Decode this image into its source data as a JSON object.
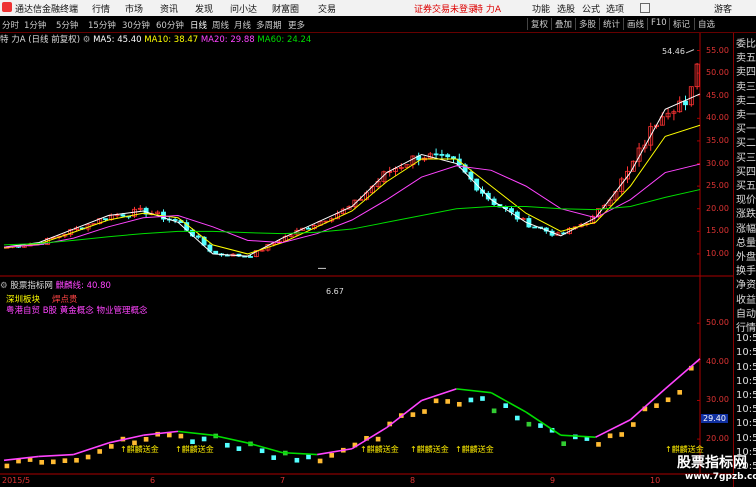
{
  "topbar": {
    "app_title": "通达信金融终端",
    "menu": [
      "行情",
      "市场",
      "资讯",
      "发现",
      "问小达",
      "财富圈",
      "交易"
    ],
    "login_status": "证券交易未登录",
    "stock_name_top": "特 力A",
    "right_menu": [
      "功能",
      "选股",
      "公式",
      "选项"
    ],
    "guest": "游客"
  },
  "toolbar": {
    "periods": [
      "分时",
      "1分钟",
      "5分钟",
      "15分钟",
      "30分钟",
      "60分钟",
      "日线",
      "周线",
      "月线",
      "多周期",
      "更多"
    ],
    "active_period": "日线",
    "buttons": [
      "复权",
      "叠加",
      "多股",
      "统计",
      "画线",
      "F10",
      "标记",
      "自选"
    ]
  },
  "main_chart": {
    "stock_title": "特 力A (日线 前复权)",
    "ma": [
      {
        "label": "MA5: 45.40",
        "color": "#ffffff"
      },
      {
        "label": "MA10: 38.47",
        "color": "#ffff00"
      },
      {
        "label": "MA20: 29.88",
        "color": "#ff44ff"
      },
      {
        "label": "MA60: 24.24",
        "color": "#00dd00"
      }
    ],
    "high_label": "54.46",
    "low_label": "6.67",
    "y_ticks": [
      "55.00",
      "50.00",
      "45.00",
      "40.00",
      "35.00",
      "30.00",
      "25.00",
      "20.00",
      "15.00",
      "10.00"
    ],
    "y_range": [
      6,
      56
    ]
  },
  "indicator": {
    "title": "股票指标网",
    "series_label": "麒麟线: 40.80",
    "sector_label": "深圳板块",
    "sector_value": "焊点贵",
    "concepts": "粤港自贸 B股 黄金概念 物业管理概念",
    "current_value": "29.40",
    "y_ticks": [
      "50.00",
      "40.00",
      "30.00",
      "20.00"
    ],
    "y_range": [
      12,
      56
    ],
    "signal_text": "麒麟送金"
  },
  "x_dates": [
    "2015/5",
    "6",
    "7",
    "8",
    "9",
    "10"
  ],
  "side_panel": {
    "items": [
      "委比",
      "卖五",
      "卖四",
      "卖三",
      "卖二",
      "卖一",
      "买一",
      "买二",
      "买三",
      "买四",
      "买五",
      "现价",
      "涨跌",
      "涨幅",
      "总量",
      "外盘",
      "换手",
      "净资",
      "收益",
      "自动",
      "行情",
      "10:5",
      "10:5",
      "10:5",
      "10:5",
      "10:5",
      "10:5",
      "10:5",
      "10:5",
      "10:5",
      "10:5"
    ]
  },
  "watermark": {
    "line1": "股票指标网",
    "line2": "www.7gpzb.com"
  },
  "colors": {
    "up": "#ff3333",
    "down": "#54ffff",
    "ma5": "#ffffff",
    "ma10": "#ffff00",
    "ma20": "#ff44ff",
    "ma60": "#00dd00",
    "axis": "#aa0000"
  },
  "chart_data": {
    "type": "candlestick",
    "categories": [
      "2015/5",
      "6",
      "7",
      "8",
      "9",
      "10"
    ],
    "series": [
      {
        "name": "MA5",
        "values": [
          11.5,
          12.5,
          15.5,
          18.5,
          19.5,
          17,
          10,
          9.5,
          13.5,
          17,
          20.5,
          28,
          32,
          30,
          22,
          17,
          14,
          18,
          28,
          42,
          45.4
        ]
      },
      {
        "name": "MA10",
        "values": [
          11.3,
          12.2,
          14.8,
          17.5,
          19,
          18,
          12,
          10,
          12.5,
          16,
          19.5,
          26,
          31,
          31,
          25,
          19,
          15,
          17,
          25,
          36,
          38.47
        ]
      },
      {
        "name": "MA20",
        "values": [
          11.5,
          12,
          13.5,
          16,
          18,
          18.5,
          16,
          13,
          12.5,
          14.5,
          17.5,
          22,
          27,
          29.5,
          28.5,
          25,
          20,
          18,
          22,
          28,
          29.88
        ]
      },
      {
        "name": "MA60",
        "values": [
          12,
          12.3,
          13,
          13.8,
          14.5,
          15,
          15,
          14.7,
          14.5,
          14.8,
          15.5,
          17,
          18.5,
          20,
          20.5,
          20.5,
          20,
          19.8,
          20.5,
          22.5,
          24.24
        ]
      },
      {
        "name": "麒麟线",
        "values": [
          14.5,
          15.5,
          16,
          19,
          21,
          22,
          21,
          19,
          16.5,
          16,
          17.5,
          23,
          30,
          33,
          32,
          27,
          21,
          20.5,
          25,
          33,
          40.8
        ]
      }
    ],
    "ylim": [
      6,
      56
    ]
  }
}
